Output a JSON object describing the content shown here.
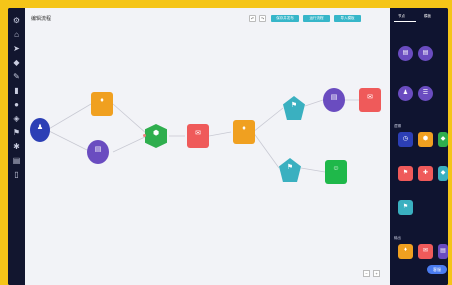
{
  "canvas": {
    "title": "编辑流程"
  },
  "toolbar": {
    "buttons": [
      "保存并发布",
      "运行流程",
      "导入模板"
    ],
    "icon_buttons": [
      "undo-icon",
      "redo-icon"
    ]
  },
  "palette": {
    "tabs": [
      "节点",
      "模板"
    ],
    "sections": [
      "基础",
      "逻辑",
      "输出"
    ]
  },
  "zoom": {
    "minus": "−",
    "plus": "+"
  },
  "chat": {
    "label": "客服"
  },
  "colors": {
    "accent": "#36b6c9",
    "orange": "#f0a020",
    "purple": "#6a4cc0",
    "red": "#ef5a5a",
    "green": "#2fae4e",
    "teal": "#3ab0c0",
    "navy": "#2c3fb5"
  }
}
